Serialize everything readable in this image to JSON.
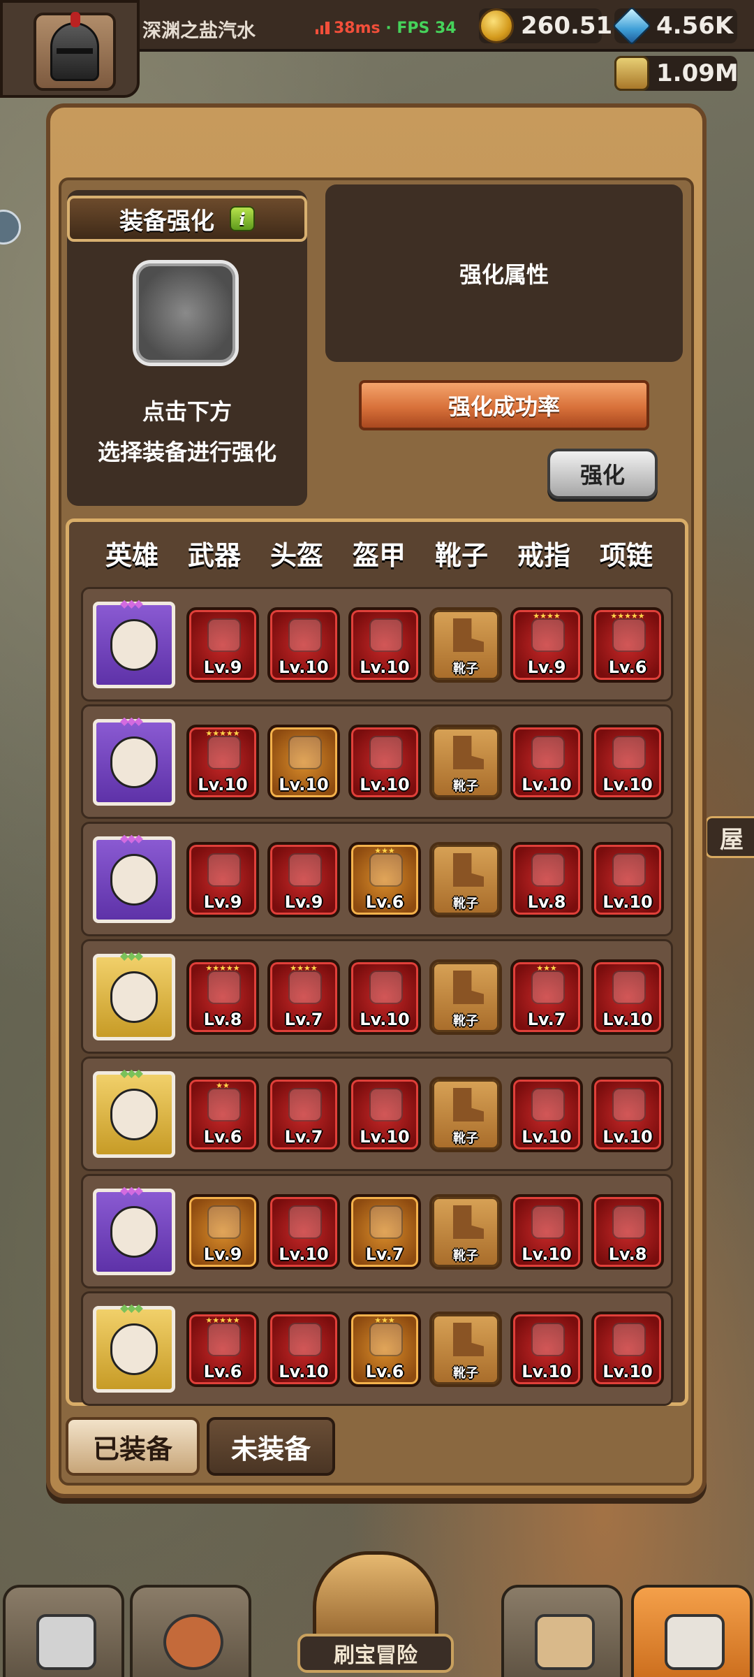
{
  "topbar": {
    "player_name": "深渊之盐汽水",
    "ping": "38ms",
    "fps": "· FPS 34",
    "gold": "260.51K",
    "gems": "4.56K",
    "potion": "1.09M"
  },
  "side": {
    "right_label": "屋"
  },
  "enhance": {
    "title": "装备强化",
    "info_icon": "i",
    "hint_line1": "点击下方",
    "hint_line2": "选择装备进行强化",
    "attributes_label": "强化属性",
    "success_rate_label": "强化成功率",
    "enhance_button": "强化"
  },
  "table": {
    "headers": [
      "英雄",
      "武器",
      "头盔",
      "盔甲",
      "靴子",
      "戒指",
      "项链"
    ],
    "rows": [
      {
        "hero": "purple",
        "items": [
          {
            "lv": "Lv.9",
            "frame": "red",
            "stars": ""
          },
          {
            "lv": "Lv.10",
            "frame": "red",
            "stars": ""
          },
          {
            "lv": "Lv.10",
            "frame": "red",
            "stars": ""
          },
          {
            "lv": "靴子",
            "frame": "empty",
            "stars": ""
          },
          {
            "lv": "Lv.9",
            "frame": "red",
            "stars": "★★★★"
          },
          {
            "lv": "Lv.6",
            "frame": "red",
            "stars": "★★★★★"
          }
        ]
      },
      {
        "hero": "purple",
        "items": [
          {
            "lv": "Lv.10",
            "frame": "red",
            "stars": "★★★★★"
          },
          {
            "lv": "Lv.10",
            "frame": "orange",
            "stars": ""
          },
          {
            "lv": "Lv.10",
            "frame": "red",
            "stars": ""
          },
          {
            "lv": "靴子",
            "frame": "empty",
            "stars": ""
          },
          {
            "lv": "Lv.10",
            "frame": "red",
            "stars": ""
          },
          {
            "lv": "Lv.10",
            "frame": "red",
            "stars": ""
          }
        ]
      },
      {
        "hero": "purple",
        "items": [
          {
            "lv": "Lv.9",
            "frame": "red",
            "stars": ""
          },
          {
            "lv": "Lv.9",
            "frame": "red",
            "stars": ""
          },
          {
            "lv": "Lv.6",
            "frame": "orange",
            "stars": "★★★"
          },
          {
            "lv": "靴子",
            "frame": "empty",
            "stars": ""
          },
          {
            "lv": "Lv.8",
            "frame": "red",
            "stars": ""
          },
          {
            "lv": "Lv.10",
            "frame": "red",
            "stars": ""
          }
        ]
      },
      {
        "hero": "gold",
        "items": [
          {
            "lv": "Lv.8",
            "frame": "red",
            "stars": "★★★★★"
          },
          {
            "lv": "Lv.7",
            "frame": "red",
            "stars": "★★★★"
          },
          {
            "lv": "Lv.10",
            "frame": "red",
            "stars": ""
          },
          {
            "lv": "靴子",
            "frame": "empty",
            "stars": ""
          },
          {
            "lv": "Lv.7",
            "frame": "red",
            "stars": "★★★"
          },
          {
            "lv": "Lv.10",
            "frame": "red",
            "stars": ""
          }
        ]
      },
      {
        "hero": "gold",
        "items": [
          {
            "lv": "Lv.6",
            "frame": "red",
            "stars": "★★"
          },
          {
            "lv": "Lv.7",
            "frame": "red",
            "stars": ""
          },
          {
            "lv": "Lv.10",
            "frame": "red",
            "stars": ""
          },
          {
            "lv": "靴子",
            "frame": "empty",
            "stars": ""
          },
          {
            "lv": "Lv.10",
            "frame": "red",
            "stars": ""
          },
          {
            "lv": "Lv.10",
            "frame": "red",
            "stars": ""
          }
        ]
      },
      {
        "hero": "purple",
        "items": [
          {
            "lv": "Lv.9",
            "frame": "orange",
            "stars": ""
          },
          {
            "lv": "Lv.10",
            "frame": "red",
            "stars": ""
          },
          {
            "lv": "Lv.7",
            "frame": "orange",
            "stars": ""
          },
          {
            "lv": "靴子",
            "frame": "empty",
            "stars": ""
          },
          {
            "lv": "Lv.10",
            "frame": "red",
            "stars": ""
          },
          {
            "lv": "Lv.8",
            "frame": "red",
            "stars": ""
          }
        ]
      },
      {
        "hero": "gold",
        "items": [
          {
            "lv": "Lv.6",
            "frame": "red",
            "stars": "★★★★★"
          },
          {
            "lv": "Lv.10",
            "frame": "red",
            "stars": ""
          },
          {
            "lv": "Lv.6",
            "frame": "orange",
            "stars": "★★★"
          },
          {
            "lv": "靴子",
            "frame": "empty",
            "stars": ""
          },
          {
            "lv": "Lv.10",
            "frame": "red",
            "stars": ""
          },
          {
            "lv": "Lv.10",
            "frame": "red",
            "stars": ""
          }
        ]
      }
    ]
  },
  "tabs": {
    "equipped": "已装备",
    "unequipped": "未装备"
  },
  "bottom_nav": {
    "adventure_label": "刷宝冒险"
  },
  "colors": {
    "accent": "#d8713a",
    "panel": "#b3864c",
    "dark": "#3e2f24"
  }
}
